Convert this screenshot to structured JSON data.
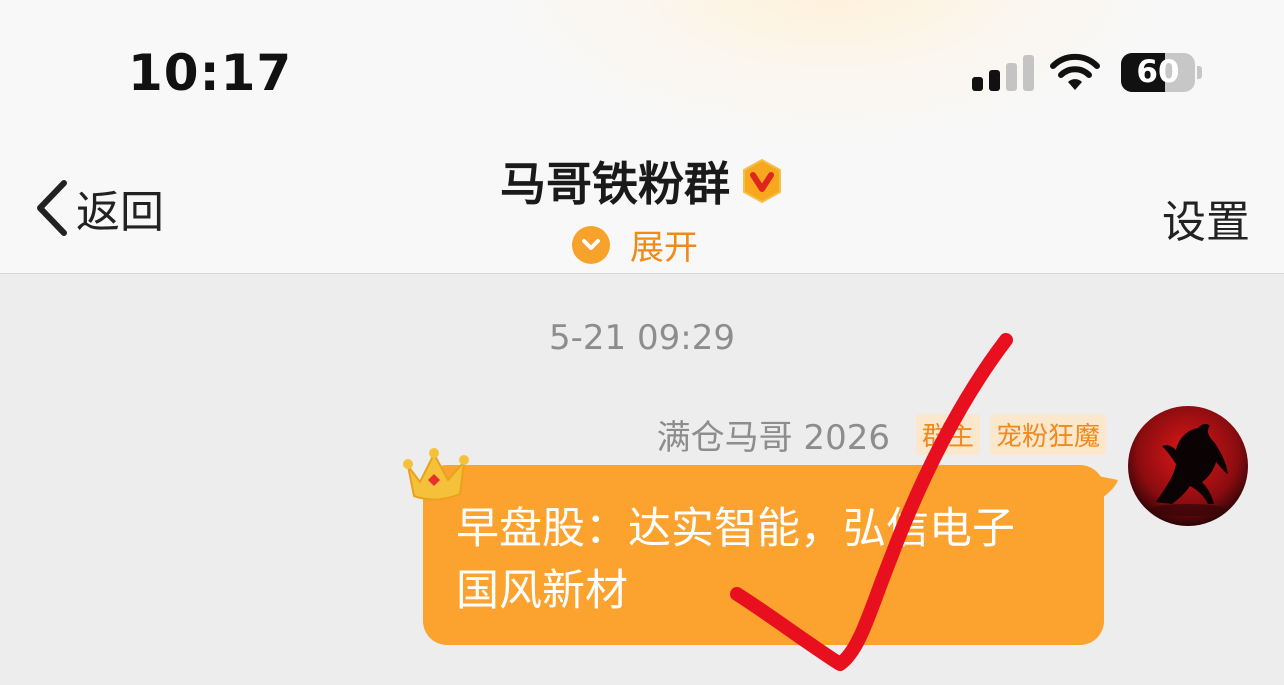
{
  "status_bar": {
    "time": "10:17",
    "battery": "60",
    "battery_level_percent": 60
  },
  "nav": {
    "back_label": "返回",
    "title": "马哥铁粉群",
    "expand_label": "展开",
    "settings_label": "设置"
  },
  "chat": {
    "timestamp": "5-21 09:29",
    "message": {
      "sender_name": "满仓马哥 2026",
      "tags": [
        "群主",
        "宠粉狂魔"
      ],
      "lines": [
        "早盘股：达实智能，弘信电子",
        "国风新材"
      ]
    }
  },
  "colors": {
    "accent_orange": "#fba22f",
    "tag_text": "#ee8a1e",
    "annotation_red": "#e8101e"
  },
  "icons": [
    "back-chevron-icon",
    "verified-v-badge-icon",
    "expand-chevron-icon",
    "cellular-signal-icon",
    "wifi-icon",
    "battery-icon",
    "crown-icon",
    "horse-avatar",
    "red-checkmark-annotation"
  ]
}
